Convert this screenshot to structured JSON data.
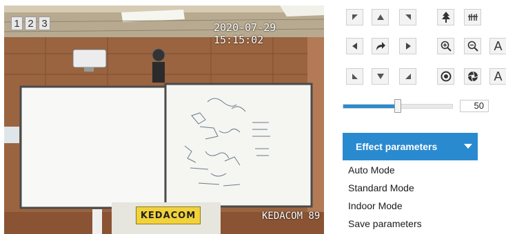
{
  "video": {
    "channel_tabs": [
      "1",
      "2",
      "3"
    ],
    "timestamp": "2020-07-29 15:15:02",
    "osd_name": "KEDACOM 89",
    "brand_label": "KEDACOM"
  },
  "ptz": {
    "buttons": [
      {
        "name": "pan-up-left",
        "icon": "triangle-up-left-icon"
      },
      {
        "name": "tilt-up",
        "icon": "triangle-up-icon"
      },
      {
        "name": "pan-up-right",
        "icon": "triangle-up-right-icon"
      },
      {
        "name": "pan-left",
        "icon": "triangle-left-icon"
      },
      {
        "name": "home",
        "icon": "curved-arrow-icon"
      },
      {
        "name": "pan-right",
        "icon": "triangle-right-icon"
      },
      {
        "name": "pan-down-left",
        "icon": "triangle-down-left-icon"
      },
      {
        "name": "tilt-down",
        "icon": "triangle-down-icon"
      },
      {
        "name": "pan-down-right",
        "icon": "triangle-down-right-icon"
      },
      {
        "name": "focus-far",
        "icon": "tree-icon"
      },
      {
        "name": "focus-near",
        "icon": "grass-icon"
      },
      {
        "name": "zoom-in",
        "icon": "zoom-in-icon"
      },
      {
        "name": "zoom-out",
        "icon": "zoom-out-icon"
      },
      {
        "name": "iris-open",
        "icon": "iris-open-icon"
      },
      {
        "name": "iris-close",
        "icon": "iris-close-icon"
      }
    ],
    "text_buttons": [
      "A",
      "A"
    ],
    "speed_value": "50",
    "speed_fraction": 0.5
  },
  "effect": {
    "title": "Effect parameters",
    "options": [
      "Auto Mode",
      "Standard Mode",
      "Indoor Mode",
      "Save parameters"
    ]
  },
  "colors": {
    "accent": "#2a8ad0",
    "slider_fill": "#2a8ccd"
  }
}
